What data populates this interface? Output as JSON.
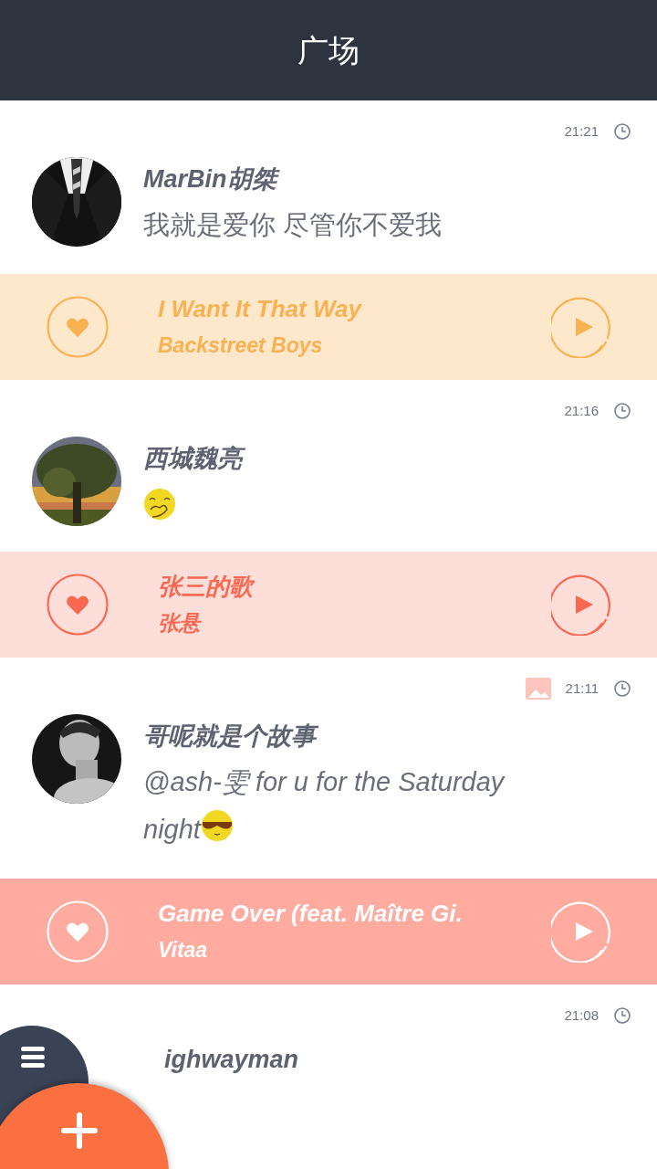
{
  "header": {
    "title": "广场"
  },
  "posts": [
    {
      "time": "21:21",
      "has_image": false,
      "name": "MarBin胡桀",
      "italic": false,
      "body": [
        {
          "kind": "text",
          "text": "我就是爱你 尽管你不爱我"
        }
      ],
      "song": {
        "title": "I Want It That Way",
        "artist": "Backstreet Boys",
        "color": "#fee8cc",
        "filled": false
      }
    },
    {
      "time": "21:16",
      "has_image": false,
      "name": "西城魏亮",
      "body": [
        {
          "kind": "blush-emoji"
        }
      ],
      "song": {
        "title": "张三的歌",
        "artist": "张悬",
        "color": "#fdded9",
        "filled": false
      }
    },
    {
      "time": "21:11",
      "has_image": true,
      "name": "哥呢就是个故事",
      "italic": true,
      "body": [
        {
          "kind": "text",
          "text": "@ash-雯 for u for the Saturday night"
        },
        {
          "kind": "cool-emoji"
        }
      ],
      "song": {
        "title": "Game Over (feat. Maître Gi.",
        "artist": "Vitaa",
        "color": "#ffab9f",
        "filled": true
      }
    },
    {
      "time": "21:08",
      "has_image": false,
      "name": "ighwayman"
    }
  ]
}
